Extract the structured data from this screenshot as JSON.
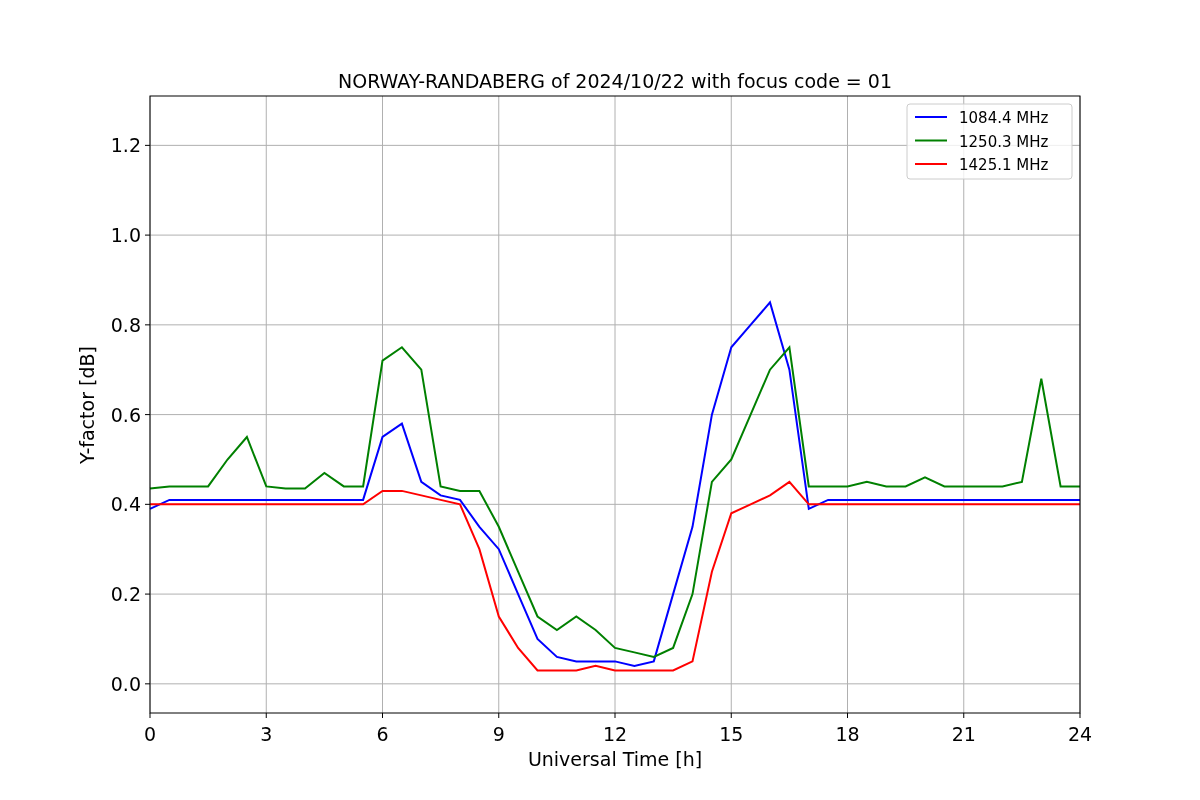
{
  "figure": {
    "chart_data": {
      "type": "line",
      "title": "NORWAY-RANDABERG of 2024/10/22 with focus code = 01",
      "xlabel": "Universal Time [h]",
      "ylabel": "Y-factor [dB]",
      "x": [
        0,
        0.5,
        1,
        1.5,
        2,
        2.5,
        3,
        3.5,
        4,
        4.5,
        5,
        5.5,
        6,
        6.5,
        7,
        7.5,
        8,
        8.5,
        9,
        9.5,
        10,
        10.5,
        11,
        11.5,
        12,
        12.5,
        13,
        13.5,
        14,
        14.5,
        15,
        15.5,
        16,
        16.5,
        17,
        17.5,
        18,
        18.5,
        19,
        19.5,
        20,
        20.5,
        21,
        21.5,
        22,
        22.5,
        23,
        23.5,
        24
      ],
      "series": [
        {
          "name": "1084.4 MHz",
          "color": "#0000ff",
          "values": [
            0.39,
            0.41,
            0.41,
            0.41,
            0.41,
            0.41,
            0.41,
            0.41,
            0.41,
            0.41,
            0.41,
            0.41,
            0.55,
            0.58,
            0.45,
            0.42,
            0.41,
            0.35,
            0.3,
            0.2,
            0.1,
            0.06,
            0.05,
            0.05,
            0.05,
            0.04,
            0.05,
            0.2,
            0.35,
            0.6,
            0.75,
            0.8,
            0.85,
            0.7,
            0.39,
            0.41,
            0.41,
            0.41,
            0.41,
            0.41,
            0.41,
            0.41,
            0.41,
            0.41,
            0.41,
            0.41,
            0.41,
            0.41,
            0.41
          ]
        },
        {
          "name": "1250.3 MHz",
          "color": "#008000",
          "values": [
            0.435,
            0.44,
            0.44,
            0.44,
            0.5,
            0.55,
            0.44,
            0.435,
            0.435,
            0.47,
            0.44,
            0.44,
            0.72,
            0.75,
            0.7,
            0.44,
            0.43,
            0.43,
            0.35,
            0.25,
            0.15,
            0.12,
            0.15,
            0.12,
            0.08,
            0.07,
            0.06,
            0.08,
            0.2,
            0.45,
            0.5,
            0.6,
            0.7,
            0.75,
            0.44,
            0.44,
            0.44,
            0.45,
            0.44,
            0.44,
            0.46,
            0.44,
            0.44,
            0.44,
            0.44,
            0.45,
            0.68,
            0.44,
            0.44
          ]
        },
        {
          "name": "1425.1 MHz",
          "color": "#ff0000",
          "values": [
            0.4,
            0.4,
            0.4,
            0.4,
            0.4,
            0.4,
            0.4,
            0.4,
            0.4,
            0.4,
            0.4,
            0.4,
            0.43,
            0.43,
            0.42,
            0.41,
            0.4,
            0.3,
            0.15,
            0.08,
            0.03,
            0.03,
            0.03,
            0.04,
            0.03,
            0.03,
            0.03,
            0.03,
            0.05,
            0.25,
            0.38,
            0.4,
            0.42,
            0.45,
            0.4,
            0.4,
            0.4,
            0.4,
            0.4,
            0.4,
            0.4,
            0.4,
            0.4,
            0.4,
            0.4,
            0.4,
            0.4,
            0.4,
            0.4
          ]
        }
      ],
      "xlim": [
        0,
        24
      ],
      "ylim": [
        -0.065,
        1.31
      ],
      "xticks": [
        0,
        3,
        6,
        9,
        12,
        15,
        18,
        21,
        24
      ],
      "yticks": [
        {
          "value": 0,
          "label": "0.0"
        },
        {
          "value": 0.2,
          "label": "0.2"
        },
        {
          "value": 0.4,
          "label": "0.4"
        },
        {
          "value": 0.6,
          "label": "0.6"
        },
        {
          "value": 0.8,
          "label": "0.8"
        },
        {
          "value": 1,
          "label": "1.0"
        },
        {
          "value": 1.2,
          "label": "1.2"
        }
      ],
      "grid": true,
      "legend": true
    }
  }
}
